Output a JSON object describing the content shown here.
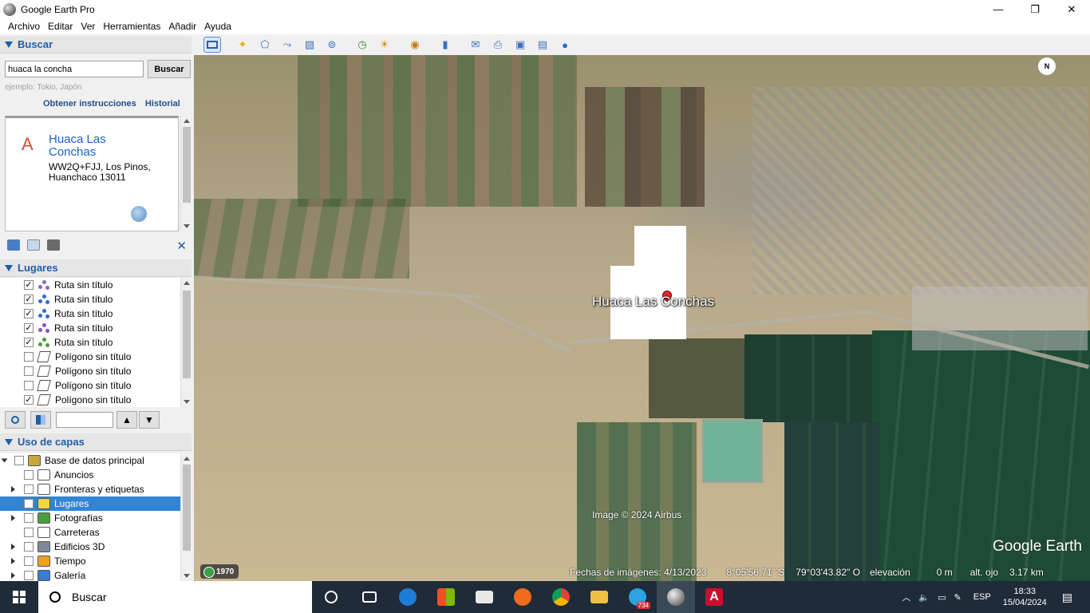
{
  "window": {
    "title": "Google Earth Pro",
    "minimize": "—",
    "maximize": "❐",
    "close": "✕"
  },
  "menu": [
    "Archivo",
    "Editar",
    "Ver",
    "Herramientas",
    "Añadir",
    "Ayuda"
  ],
  "search": {
    "header": "Buscar",
    "query": "huaca la concha",
    "button": "Buscar",
    "example": "ejemplo: Tokio, Japón",
    "link_directions": "Obtener instrucciones",
    "link_history": "Historial",
    "result": {
      "letter": "A",
      "name": "Huaca Las Conchas",
      "address": "WW2Q+FJJ, Los Pinos, Huanchaco 13011"
    }
  },
  "places": {
    "header": "Lugares",
    "items": [
      {
        "label": "Ruta sin título",
        "checked": true,
        "type": "route",
        "color": "#7a6cc9"
      },
      {
        "label": "Ruta sin título",
        "checked": true,
        "type": "route",
        "color": "#2f6bd0"
      },
      {
        "label": "Ruta sin título",
        "checked": true,
        "type": "route",
        "color": "#2f6bd0"
      },
      {
        "label": "Ruta sin título",
        "checked": true,
        "type": "route",
        "color": "#8a4fc9"
      },
      {
        "label": "Ruta sin título",
        "checked": true,
        "type": "route",
        "color": "#4e9a3a"
      },
      {
        "label": "Polígono sin título",
        "checked": false,
        "type": "polygon"
      },
      {
        "label": "Polígono sin título",
        "checked": false,
        "type": "polygon"
      },
      {
        "label": "Polígono sin título",
        "checked": false,
        "type": "polygon"
      },
      {
        "label": "Polígono sin título",
        "checked": true,
        "type": "polygon"
      }
    ]
  },
  "layers": {
    "header": "Uso de capas",
    "items": [
      {
        "label": "Base de datos principal",
        "expand": "down",
        "icon": "database-icon",
        "color": "#c9a53a"
      },
      {
        "label": "Anuncios",
        "expand": "",
        "icon": "mail-icon",
        "color": "#ffffff"
      },
      {
        "label": "Fronteras y etiquetas",
        "expand": "right",
        "icon": "flag-icon",
        "color": "#ffffff"
      },
      {
        "label": "Lugares",
        "expand": "",
        "icon": "places-icon",
        "color": "#f0d640",
        "selected": true
      },
      {
        "label": "Fotografías",
        "expand": "right",
        "icon": "photo-icon",
        "color": "#4b9f3b"
      },
      {
        "label": "Carreteras",
        "expand": "",
        "icon": "road-icon",
        "color": "#ffffff"
      },
      {
        "label": "Edificios 3D",
        "expand": "right",
        "icon": "building-icon",
        "color": "#7c8a97"
      },
      {
        "label": "Tiempo",
        "expand": "right",
        "icon": "weather-icon",
        "color": "#f0a020"
      },
      {
        "label": "Galería",
        "expand": "right",
        "icon": "gallery-icon",
        "color": "#3a7bd5"
      }
    ]
  },
  "map": {
    "label": "Huaca Las Conchas",
    "credit": "Image © 2024 Airbus",
    "logo": "Google Earth",
    "compass": "N",
    "historic_year": "1970",
    "status": {
      "date": "Fechas de imágenes: 4/13/2023",
      "lat": "8°05'56.71\" S",
      "lon": "79°03'43.82\" O",
      "elev_label": "elevación",
      "elev_value": "0 m",
      "eye_label": "alt. ojo",
      "eye_value": "3.17 km"
    }
  },
  "taskbar": {
    "search": "Buscar",
    "telegram_badge": "734",
    "lang": "ESP",
    "time": "18:33",
    "date": "15/04/2024"
  }
}
